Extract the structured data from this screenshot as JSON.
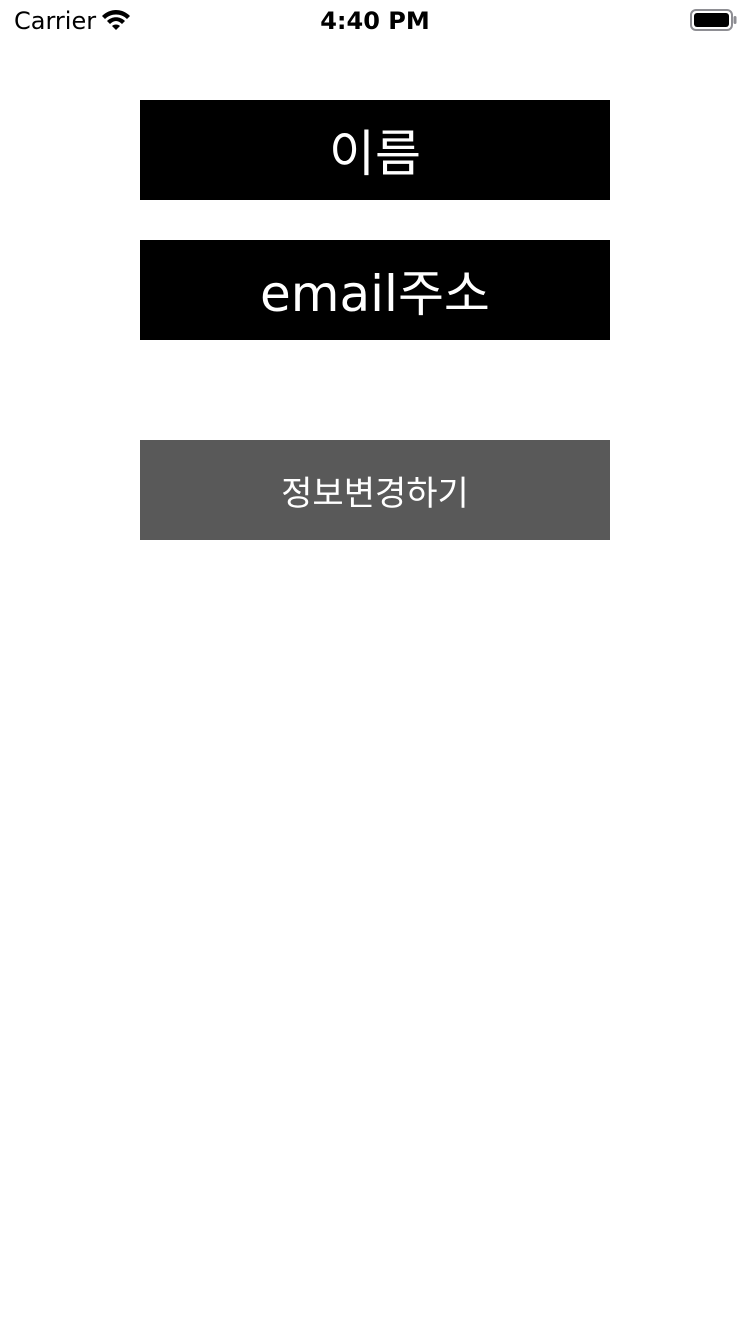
{
  "status_bar": {
    "carrier": "Carrier",
    "time": "4:40 PM",
    "wifi_icon": "wifi-icon",
    "battery_icon": "battery-full-icon"
  },
  "profile": {
    "name_label": "이름",
    "email_label": "email주소"
  },
  "actions": {
    "change_info_label": "정보변경하기"
  },
  "colors": {
    "label_background": "#000000",
    "button_background": "#595959",
    "text": "#FFFFFF",
    "page_background": "#FFFFFF"
  }
}
